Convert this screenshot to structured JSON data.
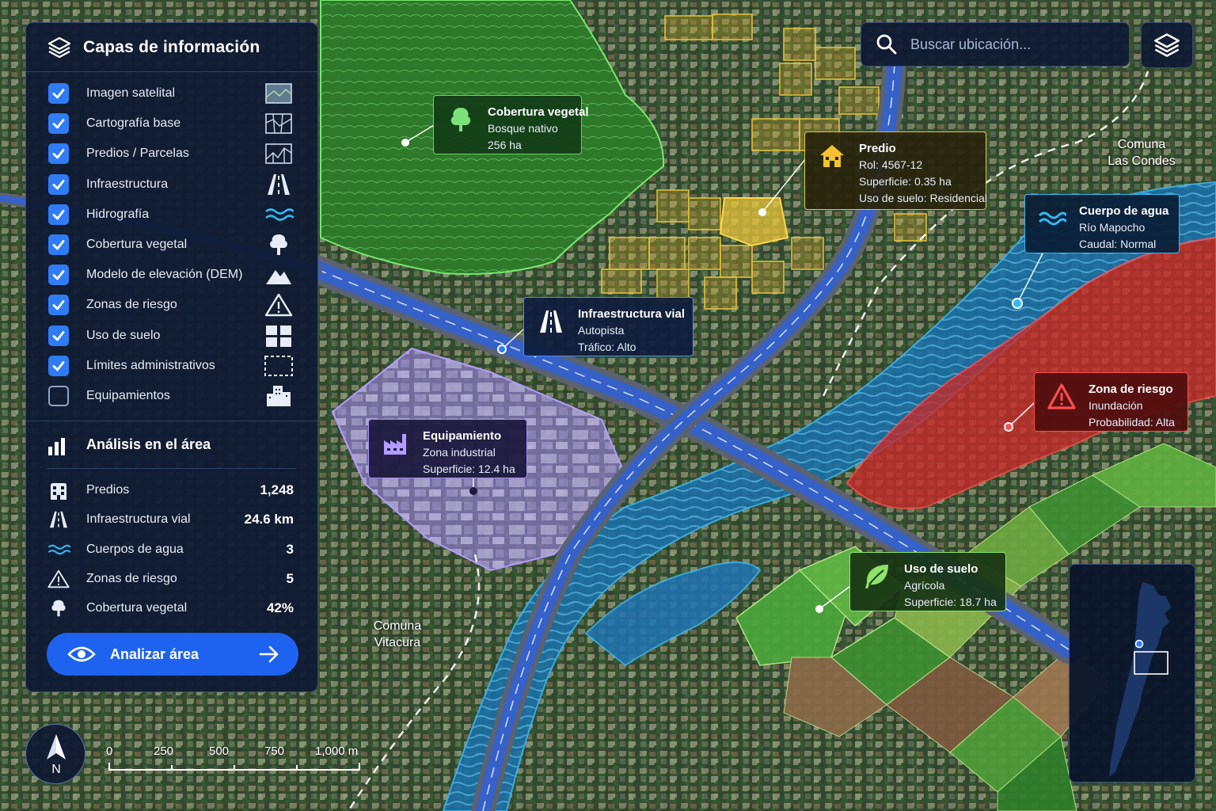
{
  "panel": {
    "title": "Capas de información",
    "layers": [
      {
        "label": "Imagen satelital",
        "checked": true,
        "icon": "satellite-image-icon"
      },
      {
        "label": "Cartografía base",
        "checked": true,
        "icon": "base-map-icon"
      },
      {
        "label": "Predios / Parcelas",
        "checked": true,
        "icon": "parcels-icon"
      },
      {
        "label": "Infraestructura",
        "checked": true,
        "icon": "road-icon"
      },
      {
        "label": "Hidrografía",
        "checked": true,
        "icon": "water-icon"
      },
      {
        "label": "Cobertura vegetal",
        "checked": true,
        "icon": "tree-icon"
      },
      {
        "label": "Modelo de elevación (DEM)",
        "checked": true,
        "icon": "mountain-icon"
      },
      {
        "label": "Zonas de riesgo",
        "checked": true,
        "icon": "warning-icon"
      },
      {
        "label": "Uso de suelo",
        "checked": true,
        "icon": "grid-icon"
      },
      {
        "label": "Límites administrativos",
        "checked": true,
        "icon": "dashed-border-icon"
      },
      {
        "label": "Equipamientos",
        "checked": false,
        "icon": "buildings-icon"
      }
    ]
  },
  "analysis": {
    "title": "Análisis en el área",
    "stats": [
      {
        "label": "Predios",
        "value": "1,248",
        "icon": "building-icon"
      },
      {
        "label": "Infraestructura vial",
        "value": "24.6 km",
        "icon": "road-icon"
      },
      {
        "label": "Cuerpos de agua",
        "value": "3",
        "icon": "water-icon"
      },
      {
        "label": "Zonas de riesgo",
        "value": "5",
        "icon": "warning-icon"
      },
      {
        "label": "Cobertura vegetal",
        "value": "42%",
        "icon": "tree-icon"
      }
    ],
    "button_label": "Analizar área"
  },
  "search": {
    "placeholder": "Buscar ubicación..."
  },
  "callouts": {
    "vegetation": {
      "title": "Cobertura vegetal",
      "lines": [
        "Bosque nativo",
        "256 ha"
      ]
    },
    "parcel": {
      "title": "Predio",
      "lines": [
        "Rol: 4567-12",
        "Superficie: 0.35 ha",
        "Uso de suelo: Residencial"
      ]
    },
    "water": {
      "title": "Cuerpo de agua",
      "lines": [
        "Río Mapocho",
        "Caudal: Normal"
      ]
    },
    "road": {
      "title": "Infraestructura vial",
      "lines": [
        "Autopista",
        "Tráfico: Alto"
      ]
    },
    "facility": {
      "title": "Equipamiento",
      "lines": [
        "Zona industrial",
        "Superficie: 12.4 ha"
      ]
    },
    "risk": {
      "title": "Zona de riesgo",
      "lines": [
        "Inundación",
        "Probabilidad: Alta"
      ]
    },
    "landuse": {
      "title": "Uso de suelo",
      "lines": [
        "Agrícola",
        "Superficie: 18.7 ha"
      ]
    }
  },
  "map_labels": {
    "las_condes": [
      "Comuna",
      "Las Condes"
    ],
    "vitacura": [
      "Comuna",
      "Vitacura"
    ]
  },
  "compass": {
    "label": "N"
  },
  "scale": {
    "ticks": [
      "0",
      "250",
      "500",
      "750",
      "1,000 m"
    ]
  },
  "colors": {
    "accent": "#1e63f0",
    "vegetation": "#6dd16b",
    "parcel": "#e8c43a",
    "water": "#35b8f2",
    "road": "#4c8cf5",
    "facility": "#a58cf3",
    "risk": "#ff4d4d",
    "landuse": "#8ee36a"
  }
}
